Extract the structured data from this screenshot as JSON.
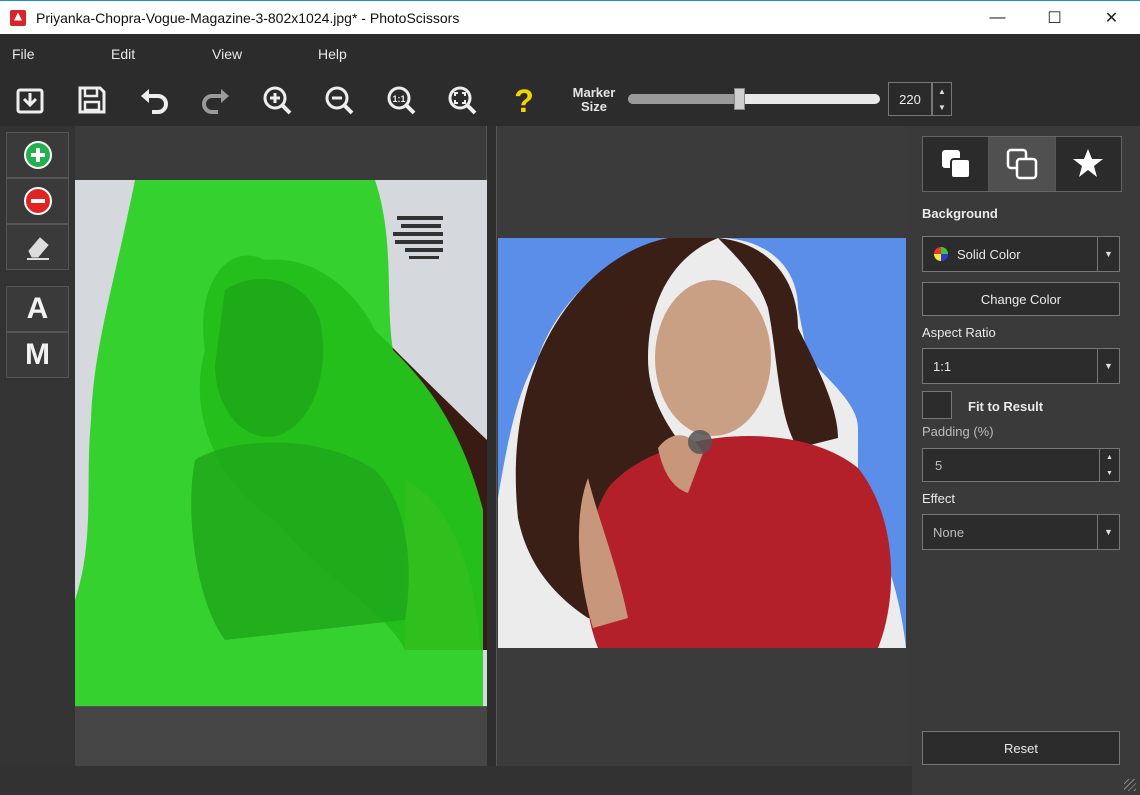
{
  "window": {
    "title": "Priyanka-Chopra-Vogue-Magazine-3-802x1024.jpg* - PhotoScissors",
    "minimize_glyph": "—",
    "maximize_glyph": "☐",
    "close_glyph": "✕"
  },
  "menu": {
    "items": [
      {
        "label": "File"
      },
      {
        "label": "Edit"
      },
      {
        "label": "View"
      },
      {
        "label": "Help"
      }
    ]
  },
  "toolbar": {
    "buttons": [
      {
        "icon": "open-icon"
      },
      {
        "icon": "save-icon"
      },
      {
        "icon": "undo-icon"
      },
      {
        "icon": "redo-icon"
      },
      {
        "icon": "zoom-in-icon"
      },
      {
        "icon": "zoom-out-icon"
      },
      {
        "icon": "zoom-actual-size-icon"
      },
      {
        "icon": "zoom-fit-icon"
      },
      {
        "icon": "help-icon"
      }
    ],
    "marker_label_line1": "Marker",
    "marker_label_line2": "Size",
    "marker_size": "220",
    "marker_slider_fraction": 0.44
  },
  "left_tools": {
    "add_marker": {
      "icon": "plus-circle-icon",
      "color": "#22b14c"
    },
    "remove_marker": {
      "icon": "minus-circle-icon",
      "color": "#e02424"
    },
    "eraser": {
      "icon": "eraser-icon"
    },
    "auto_label": "A",
    "manual_label": "M"
  },
  "right_panel": {
    "tabs": [
      {
        "icon": "background-layers-icon"
      },
      {
        "icon": "foreground-layers-icon"
      },
      {
        "icon": "star-icon"
      }
    ],
    "background_label": "Background",
    "background_type": "Solid Color",
    "change_color_label": "Change Color",
    "aspect_ratio_label": "Aspect Ratio",
    "aspect_ratio_value": "1:1",
    "fit_to_result_label": "Fit to Result",
    "padding_label": "Padding (%)",
    "padding_value": "5",
    "effect_label": "Effect",
    "effect_value": "None",
    "reset_label": "Reset"
  },
  "colors": {
    "background_color": "#5a8ee8",
    "foreground_marker": "#22c41c",
    "accent_help": "#f5d400"
  }
}
